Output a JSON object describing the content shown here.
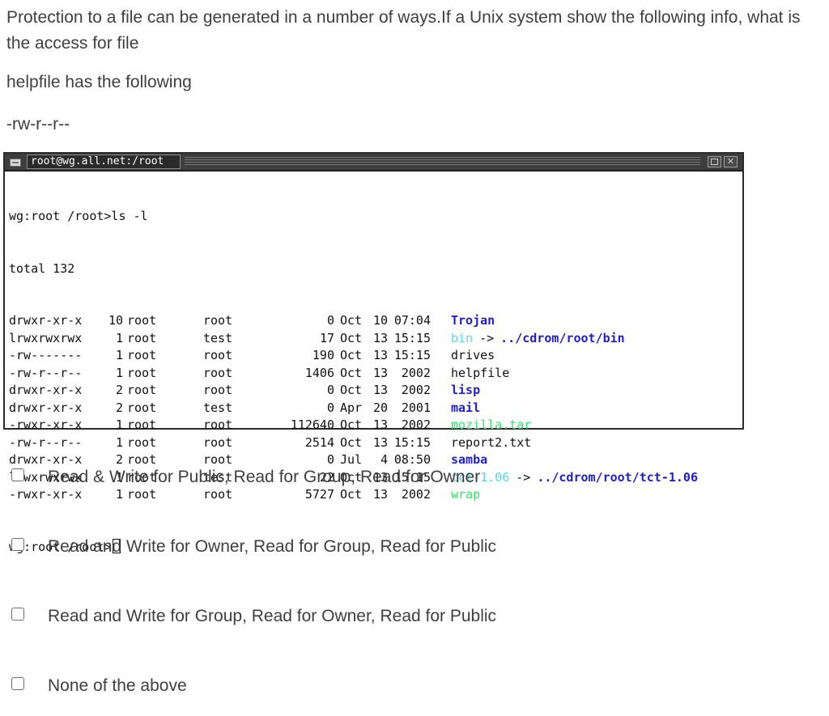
{
  "question": {
    "line1": "Protection to a file can be generated in a number of ways.If a Unix system show the following info, what is the access for file",
    "line2": "helpfile has the following",
    "line3": "-rw-r--r--"
  },
  "terminal": {
    "window_title": "root@wg.all.net:/root",
    "prompt_line": "wg:root /root>ls -l",
    "total_line": "total 132",
    "rows": [
      {
        "perm": "drwxr-xr-x",
        "links": "10",
        "owner": "root",
        "group": "root",
        "size": "0",
        "month": "Oct",
        "day": "10",
        "time": "07:04",
        "name": "Trojan",
        "name_color": "#1f1fd0",
        "name_bold": true,
        "arrow": "",
        "target": ""
      },
      {
        "perm": "lrwxrwxrwx",
        "links": "1",
        "owner": "root",
        "group": "test",
        "size": "17",
        "month": "Oct",
        "day": "13",
        "time": "15:15",
        "name": "bin",
        "name_color": "#5fd4e6",
        "name_bold": false,
        "arrow": "->",
        "target": "../cdrom/root/bin"
      },
      {
        "perm": "-rw-------",
        "links": "1",
        "owner": "root",
        "group": "root",
        "size": "190",
        "month": "Oct",
        "day": "13",
        "time": "15:15",
        "name": "drives",
        "name_color": "#111111",
        "name_bold": false,
        "arrow": "",
        "target": ""
      },
      {
        "perm": "-rw-r--r--",
        "links": "1",
        "owner": "root",
        "group": "root",
        "size": "1406",
        "month": "Oct",
        "day": "13",
        "time": "2002",
        "name": "helpfile",
        "name_color": "#111111",
        "name_bold": false,
        "arrow": "",
        "target": ""
      },
      {
        "perm": "drwxr-xr-x",
        "links": "2",
        "owner": "root",
        "group": "root",
        "size": "0",
        "month": "Oct",
        "day": "13",
        "time": "2002",
        "name": "lisp",
        "name_color": "#1f1fd0",
        "name_bold": true,
        "arrow": "",
        "target": ""
      },
      {
        "perm": "drwxr-xr-x",
        "links": "2",
        "owner": "root",
        "group": "test",
        "size": "0",
        "month": "Apr",
        "day": "20",
        "time": "2001",
        "name": "mail",
        "name_color": "#1f1fd0",
        "name_bold": true,
        "arrow": "",
        "target": ""
      },
      {
        "perm": "-rwxr-xr-x",
        "links": "1",
        "owner": "root",
        "group": "root",
        "size": "112640",
        "month": "Oct",
        "day": "13",
        "time": "2002",
        "name": "mozilla.tar",
        "name_color": "#3ce070",
        "name_bold": false,
        "arrow": "",
        "target": ""
      },
      {
        "perm": "-rw-r--r--",
        "links": "1",
        "owner": "root",
        "group": "root",
        "size": "2514",
        "month": "Oct",
        "day": "13",
        "time": "15:15",
        "name": "report2.txt",
        "name_color": "#111111",
        "name_bold": false,
        "arrow": "",
        "target": ""
      },
      {
        "perm": "drwxr-xr-x",
        "links": "2",
        "owner": "root",
        "group": "root",
        "size": "0",
        "month": "Jul",
        "day": "4",
        "time": "08:50",
        "name": "samba",
        "name_color": "#1f1fd0",
        "name_bold": true,
        "arrow": "",
        "target": ""
      },
      {
        "perm": "lrwxrwxrwx",
        "links": "1",
        "owner": "root",
        "group": "test",
        "size": "22",
        "month": "Oct",
        "day": "13",
        "time": "15:15",
        "name": "tct-1.06",
        "name_color": "#5fd4e6",
        "name_bold": false,
        "arrow": "->",
        "target": "../cdrom/root/tct-1.06"
      },
      {
        "perm": "-rwxr-xr-x",
        "links": "1",
        "owner": "root",
        "group": "root",
        "size": "5727",
        "month": "Oct",
        "day": "13",
        "time": "2002",
        "name": "wrap",
        "name_color": "#3ce070",
        "name_bold": false,
        "arrow": "",
        "target": ""
      }
    ],
    "final_prompt": "wg:root /root>"
  },
  "options": [
    {
      "label": "Read & Write for Public, Read for Group, Read for Owner",
      "checked": false
    },
    {
      "label": "Read and Write for Owner, Read for Group, Read for Public",
      "checked": false
    },
    {
      "label": "Read and Write for Group, Read for Owner, Read for Public",
      "checked": false
    },
    {
      "label": "None of the above",
      "checked": false
    }
  ]
}
